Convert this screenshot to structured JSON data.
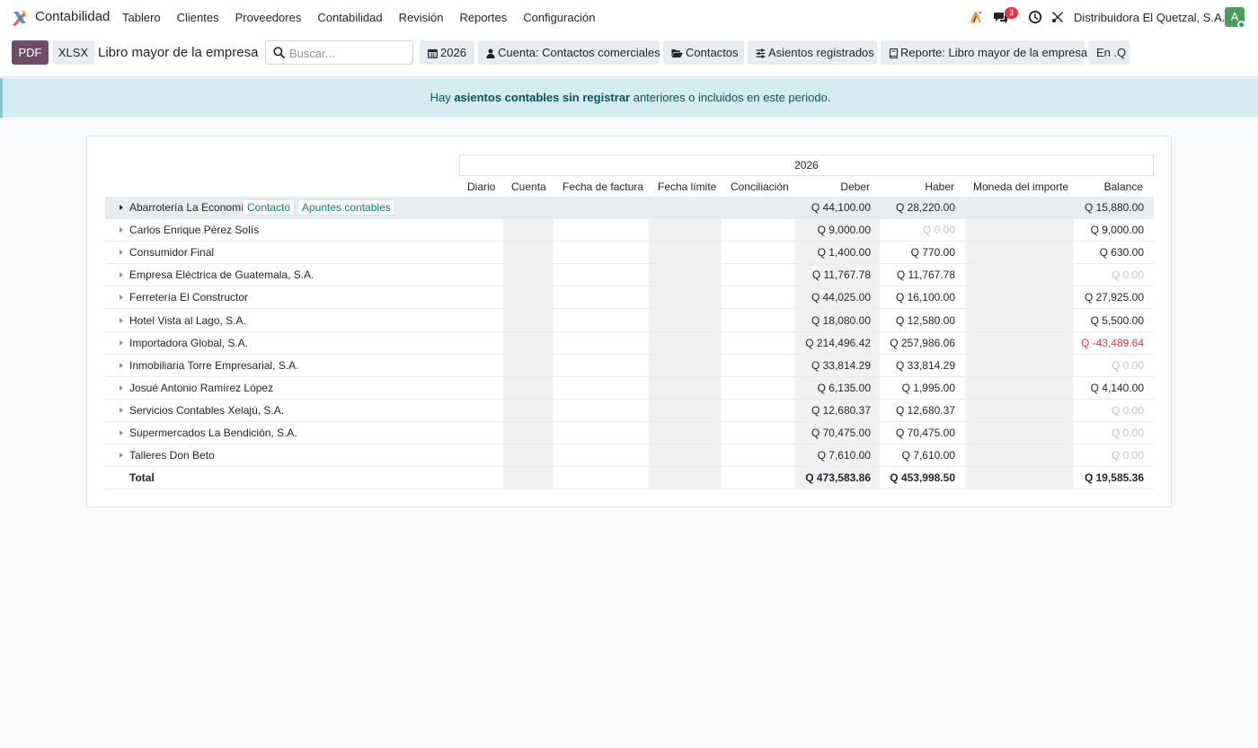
{
  "app": {
    "name": "Contabilidad"
  },
  "menu": [
    "Tablero",
    "Clientes",
    "Proveedores",
    "Contabilidad",
    "Revisión",
    "Reportes",
    "Configuración"
  ],
  "nav": {
    "messages_count": "3",
    "company": "Distribuidora El Quetzal, S.A.",
    "avatar_letter": "A"
  },
  "toolbar": {
    "pdf": "PDF",
    "xlsx": "XLSX",
    "title": "Libro mayor de la empresa",
    "search_placeholder": "Buscar...",
    "filters": {
      "period": "2026",
      "account": "Cuenta: Contactos comerciales",
      "partners": "Contactos",
      "entries": "Asientos registrados",
      "report": "Reporte: Libro mayor de la empresa",
      "currency": "En .Q"
    }
  },
  "alert": {
    "pre": "Hay ",
    "strong": "asientos contables sin registrar",
    "post": " anteriores o incluidos en este periodo."
  },
  "report": {
    "period_header": "2026",
    "columns": {
      "journal": "Diario",
      "account": "Cuenta",
      "invoice_date": "Fecha de factura",
      "due_date": "Fecha límite",
      "matching": "Conciliación",
      "debit": "Deber",
      "credit": "Haber",
      "amount_currency": "Moneda del importe",
      "balance": "Balance"
    },
    "row_actions": {
      "contact": "Contacto",
      "entries": "Apuntes contables"
    },
    "rows": [
      {
        "name": "Abarrotería La Economía",
        "debit": "Q 44,100.00",
        "credit": "Q 28,220.00",
        "balance": "Q 15,880.00"
      },
      {
        "name": "Carlos Enrique Pérez Solís",
        "debit": "Q 9,000.00",
        "credit": "Q 0.00",
        "balance": "Q 9,000.00"
      },
      {
        "name": "Consumidor Final",
        "debit": "Q 1,400.00",
        "credit": "Q 770.00",
        "balance": "Q 630.00"
      },
      {
        "name": "Empresa Eléctrica de Guatemala, S.A.",
        "debit": "Q 11,767.78",
        "credit": "Q 11,767.78",
        "balance": "Q 0.00"
      },
      {
        "name": "Ferretería El Constructor",
        "debit": "Q 44,025.00",
        "credit": "Q 16,100.00",
        "balance": "Q 27,925.00"
      },
      {
        "name": "Hotel Vista al Lago, S.A.",
        "debit": "Q 18,080.00",
        "credit": "Q 12,580.00",
        "balance": "Q 5,500.00"
      },
      {
        "name": "Importadora Global, S.A.",
        "debit": "Q 214,496.42",
        "credit": "Q 257,986.06",
        "balance": "Q -43,489.64"
      },
      {
        "name": "Inmobiliaria Torre Empresarial, S.A.",
        "debit": "Q 33,814.29",
        "credit": "Q 33,814.29",
        "balance": "Q 0.00"
      },
      {
        "name": "Josué Antonio Ramírez López",
        "debit": "Q 6,135.00",
        "credit": "Q 1,995.00",
        "balance": "Q 4,140.00"
      },
      {
        "name": "Servicios Contables Xelajú, S.A.",
        "debit": "Q 12,680.37",
        "credit": "Q 12,680.37",
        "balance": "Q 0.00"
      },
      {
        "name": "Supermercados La Bendición, S.A.",
        "debit": "Q 70,475.00",
        "credit": "Q 70,475.00",
        "balance": "Q 0.00"
      },
      {
        "name": "Talleres Don Beto",
        "debit": "Q 7,610.00",
        "credit": "Q 7,610.00",
        "balance": "Q 0.00"
      }
    ],
    "total": {
      "name": "Total",
      "debit": "Q 473,583.86",
      "credit": "Q 453,998.50",
      "balance": "Q 19,585.36"
    }
  },
  "colors": {
    "primary": "#714b67",
    "alert_bg": "#d3ecef",
    "link": "#017e84",
    "negative": "#dc3545"
  }
}
